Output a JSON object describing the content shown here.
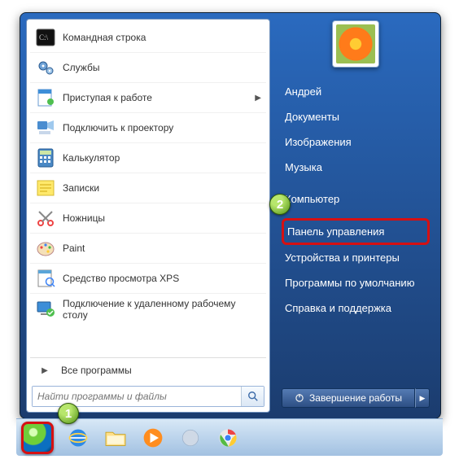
{
  "programs": [
    {
      "label": "Командная строка",
      "icon": "cmd"
    },
    {
      "label": "Службы",
      "icon": "gears"
    },
    {
      "label": "Приступая к работе",
      "icon": "doc",
      "submenu": true
    },
    {
      "label": "Подключить к проектору",
      "icon": "projector"
    },
    {
      "label": "Калькулятор",
      "icon": "calc"
    },
    {
      "label": "Записки",
      "icon": "notes"
    },
    {
      "label": "Ножницы",
      "icon": "snip"
    },
    {
      "label": "Paint",
      "icon": "paint"
    },
    {
      "label": "Средство просмотра XPS",
      "icon": "xps"
    },
    {
      "label": "Подключение к удаленному рабочему столу",
      "icon": "rdp"
    }
  ],
  "all_programs": "Все программы",
  "search_placeholder": "Найти программы и файлы",
  "right_links": [
    "Андрей",
    "Документы",
    "Изображения",
    "Музыка",
    "Компьютер",
    "Панель управления",
    "Устройства и принтеры",
    "Программы по умолчанию",
    "Справка и поддержка"
  ],
  "highlighted_right_index": 5,
  "shutdown_label": "Завершение работы",
  "callouts": {
    "one": "1",
    "two": "2"
  }
}
